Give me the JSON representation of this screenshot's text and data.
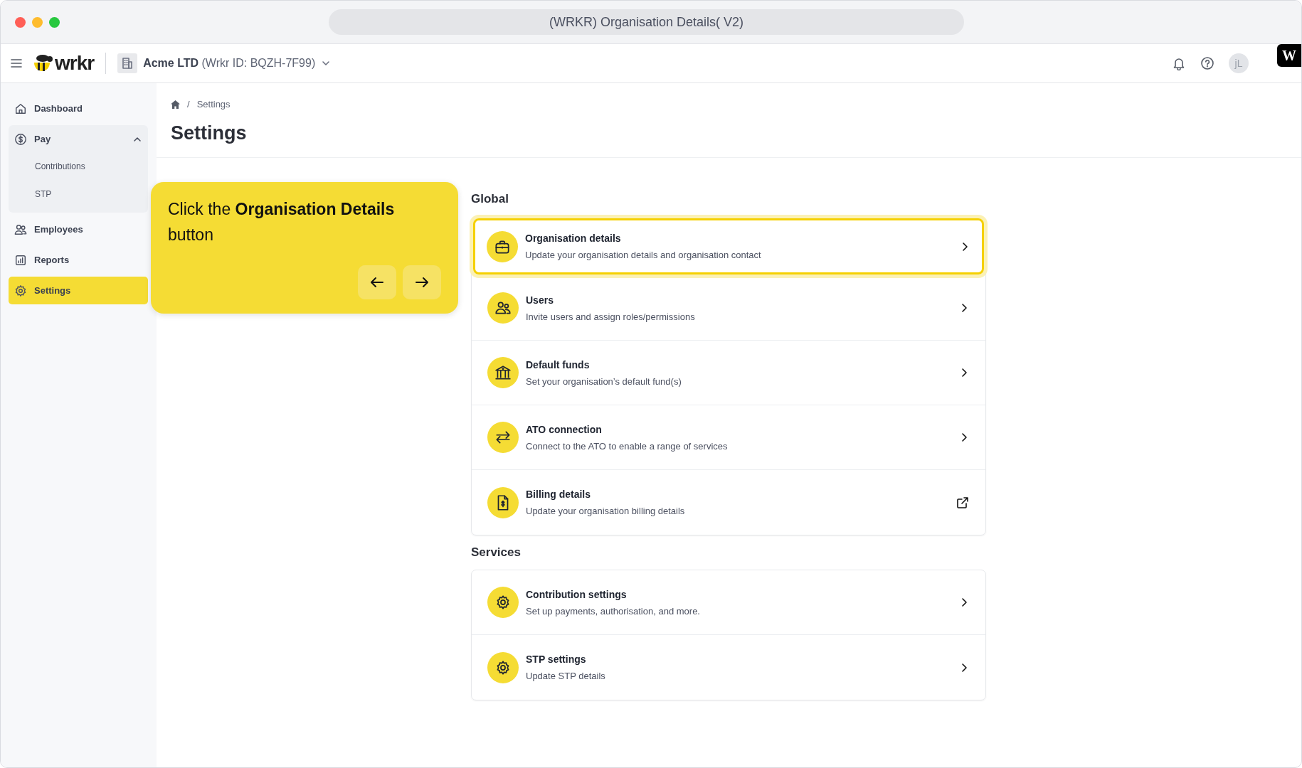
{
  "window": {
    "title": "(WRKR) Organisation Details( V2)"
  },
  "header": {
    "brand": "wrkr",
    "organisation": "Acme LTD",
    "organisation_id": "(Wrkr ID: BQZH-7F99)",
    "avatar": "jL",
    "badge": "W"
  },
  "sidebar": {
    "items": [
      {
        "label": "Dashboard",
        "selected": false
      },
      {
        "label": "Pay",
        "selected": false,
        "expanded": true,
        "children": [
          {
            "label": "Contributions",
            "selected": false
          },
          {
            "label": "STP",
            "selected": false
          }
        ]
      },
      {
        "label": "Employees",
        "selected": false
      },
      {
        "label": "Reports",
        "selected": false
      },
      {
        "label": "Settings",
        "selected": true
      }
    ]
  },
  "breadcrumb": [
    {
      "separator": "/",
      "label": "Settings"
    }
  ],
  "page_title": "Settings",
  "tooltip": {
    "text": "Click the **Organisation Details** button"
  },
  "sections": [
    {
      "title": "Global",
      "rows": [
        {
          "title": "Organisation details",
          "description": "Update your organisation details and organisation contact",
          "highlighted": true,
          "kind": "link"
        },
        {
          "title": "Users",
          "description": "Invite users and assign roles/permissions",
          "highlighted": false,
          "kind": "link"
        },
        {
          "title": "Default funds",
          "description": "Set your organisation’s default fund(s)",
          "highlighted": false,
          "kind": "link"
        },
        {
          "title": "ATO connection",
          "description": "Connect to the ATO to enable a range of services",
          "highlighted": false,
          "kind": "link"
        },
        {
          "title": "Billing details",
          "description": "Update your organisation billing details",
          "highlighted": false,
          "kind": "external"
        }
      ]
    },
    {
      "title": "Services",
      "rows": [
        {
          "title": "Contribution settings",
          "description": "Set up payments, authorisation, and more.",
          "highlighted": false,
          "kind": "link"
        },
        {
          "title": "STP settings",
          "description": "Update STP details",
          "highlighted": false,
          "kind": "link"
        }
      ]
    }
  ]
}
